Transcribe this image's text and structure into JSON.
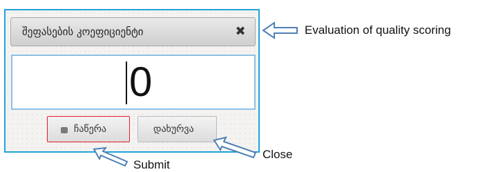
{
  "dialog": {
    "title": "შეფასების კოეფიციენტი",
    "close_glyph": "✖",
    "value": "0",
    "buttons": {
      "submit_label": "ჩაწერა",
      "close_label": "დახურვა"
    },
    "border_color": "#1fa3d8"
  },
  "annotations": {
    "title_callout": "Evaluation of quality scoring",
    "close_callout": "Close",
    "submit_callout": "Submit",
    "arrow_color": "#4f7fb5",
    "submit_highlight": "#e21b2b"
  }
}
